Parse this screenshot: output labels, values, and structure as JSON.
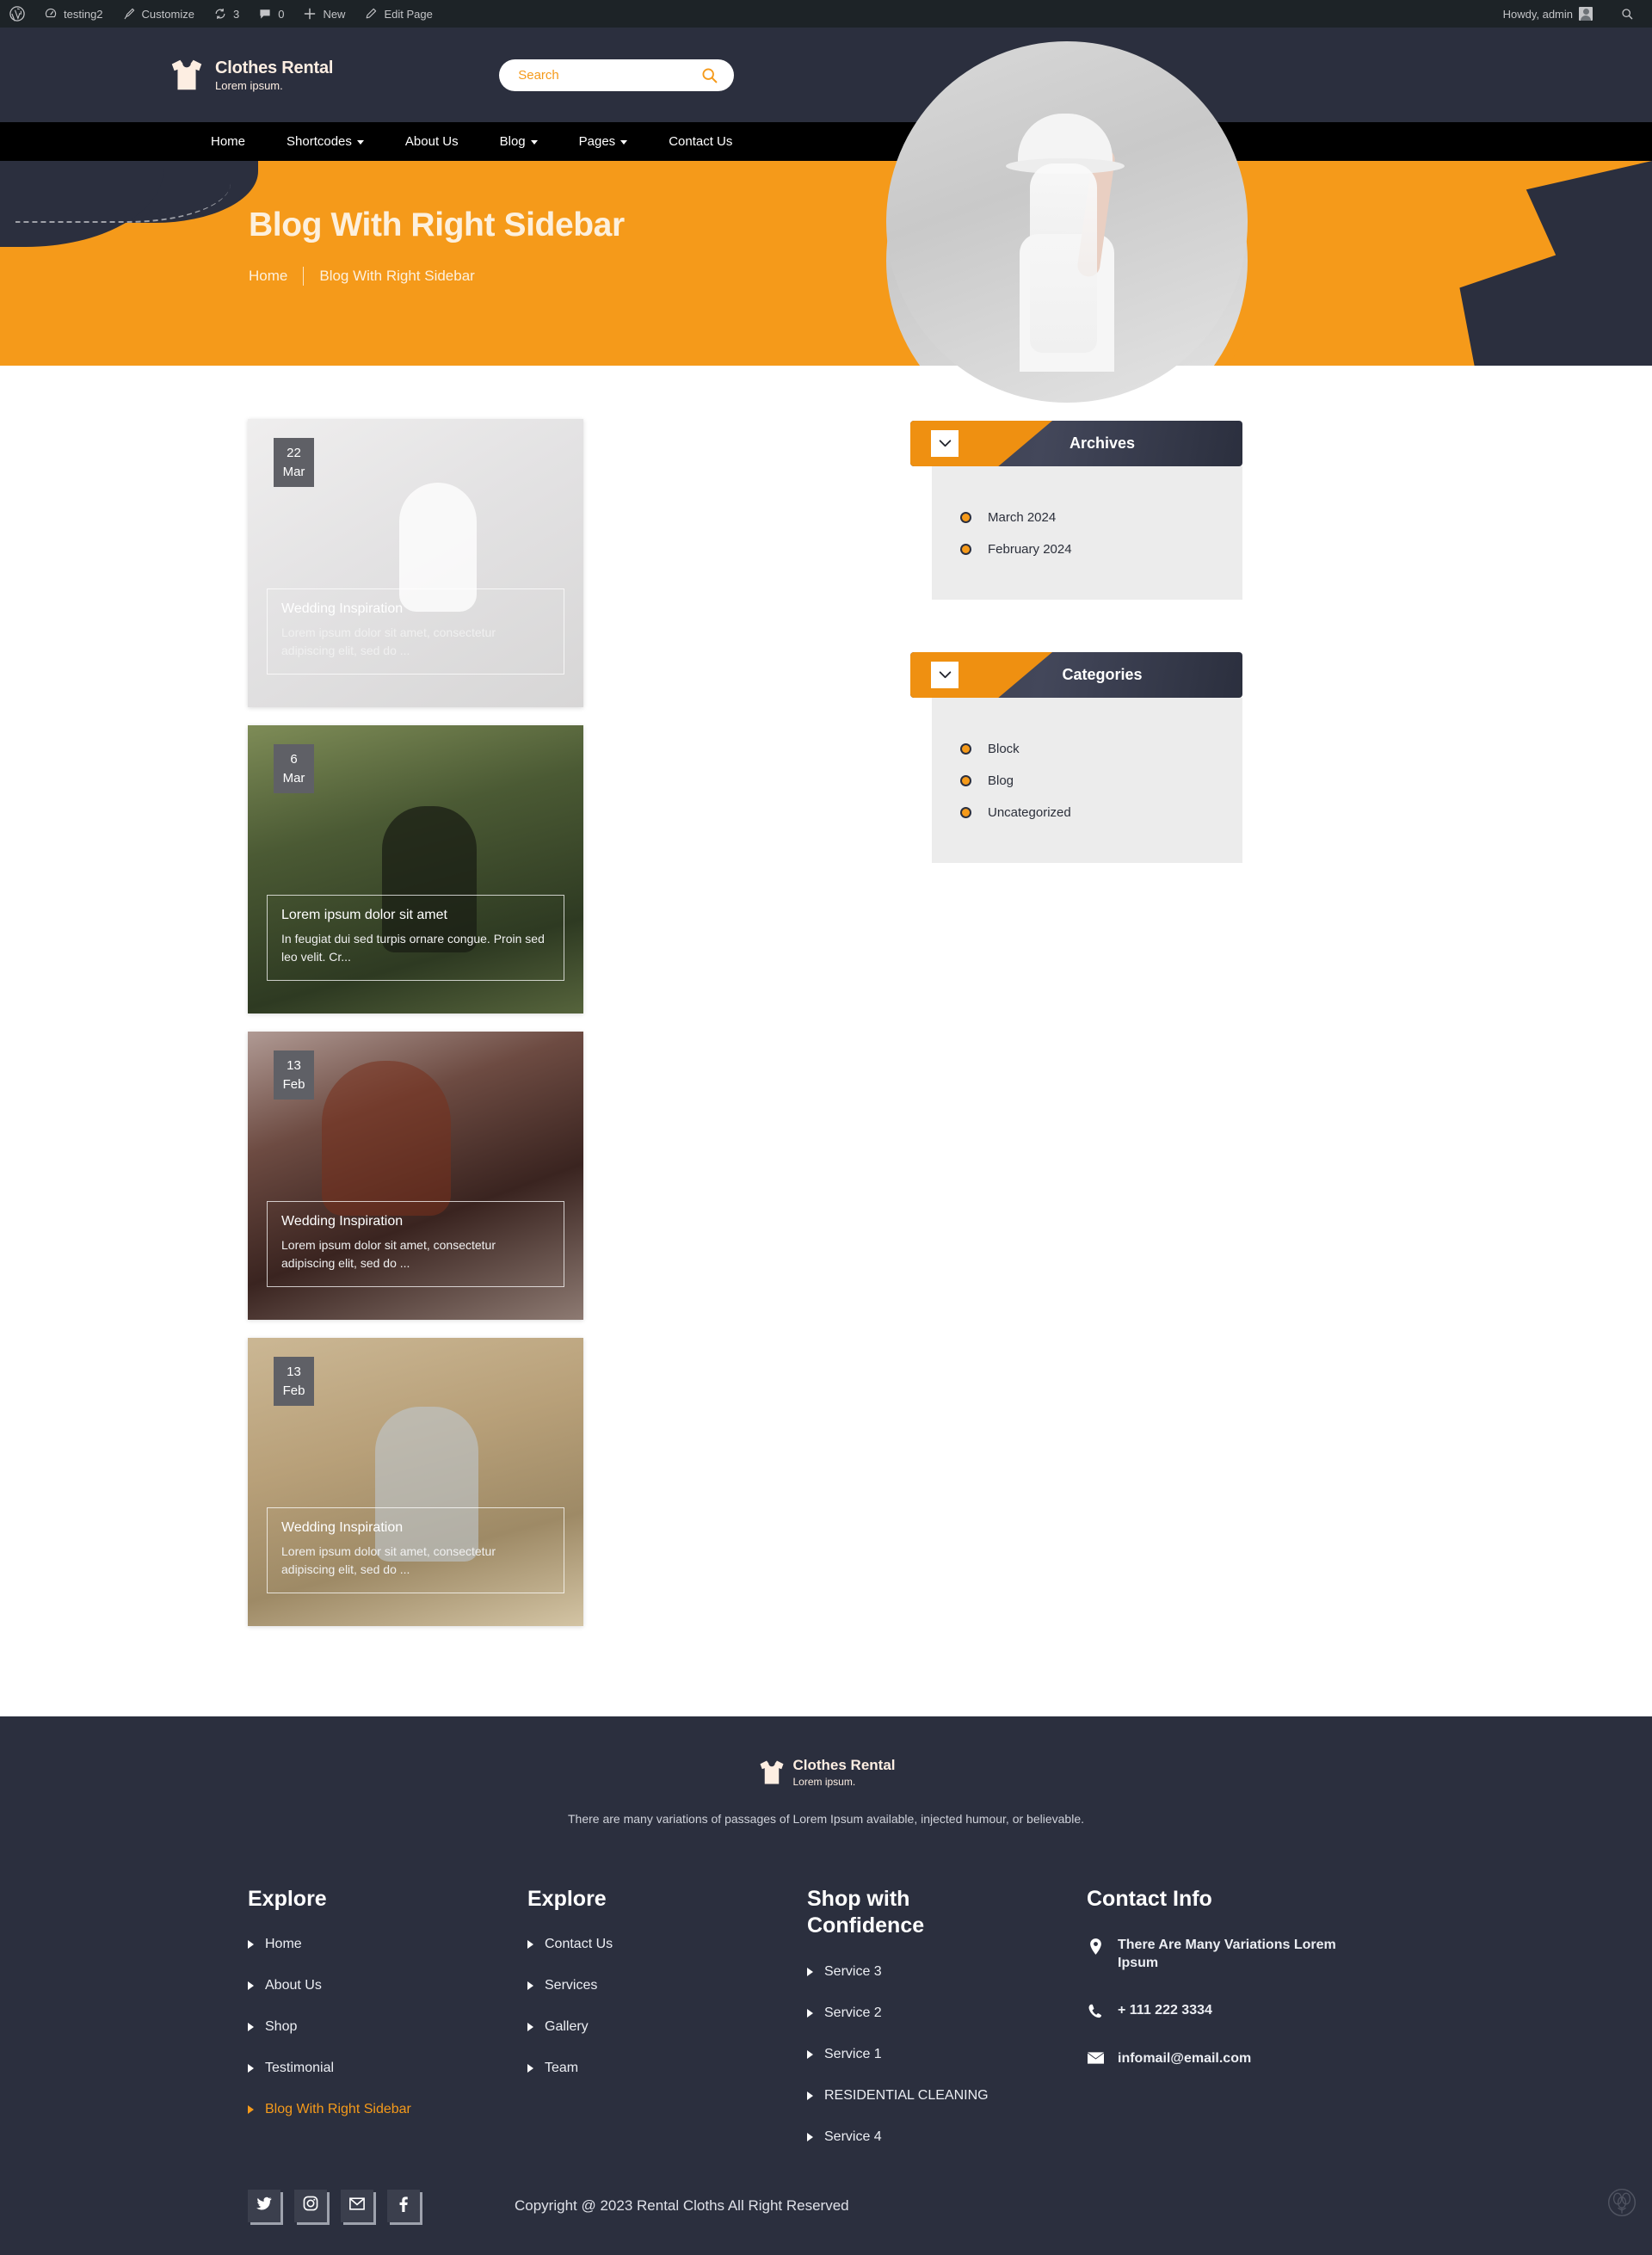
{
  "adminbar": {
    "wp_logo": "wordpress-icon",
    "site_name": "testing2",
    "customize": "Customize",
    "updates_count": "3",
    "comments_count": "0",
    "new": "New",
    "edit_page": "Edit Page",
    "howdy": "Howdy, admin",
    "search_icon": "search-icon"
  },
  "header": {
    "brand_title": "Clothes Rental",
    "brand_sub": "Lorem ipsum.",
    "search_placeholder": "Search",
    "search_value": "",
    "search_icon": "search-icon"
  },
  "nav": {
    "items": [
      {
        "label": "Home",
        "has_caret": false
      },
      {
        "label": "Shortcodes",
        "has_caret": true
      },
      {
        "label": "About Us",
        "has_caret": false
      },
      {
        "label": "Blog",
        "has_caret": true
      },
      {
        "label": "Pages",
        "has_caret": true
      },
      {
        "label": "Contact Us",
        "has_caret": false
      }
    ]
  },
  "banner": {
    "title": "Blog With Right Sidebar",
    "crumb_home": "Home",
    "crumb_current": "Blog With Right Sidebar"
  },
  "posts": [
    {
      "day": "22",
      "month": "Mar",
      "title": "Wedding Inspiration",
      "excerpt": "Lorem ipsum dolor sit amet, consectetur adipiscing elit, sed do ...",
      "image": "bride-in-white-dress"
    },
    {
      "day": "6",
      "month": "Mar",
      "title": "Lorem ipsum dolor sit amet",
      "excerpt": "In feugiat dui sed turpis ornare congue. Proin sed leo velit. Cr...",
      "image": "woman-in-black-dress-outdoors"
    },
    {
      "day": "13",
      "month": "Feb",
      "title": "Wedding Inspiration",
      "excerpt": "Lorem ipsum dolor sit amet, consectetur adipiscing elit, sed do ...",
      "image": "redhead-woman-portrait"
    },
    {
      "day": "13",
      "month": "Feb",
      "title": "Wedding Inspiration",
      "excerpt": "Lorem ipsum dolor sit amet, consectetur adipiscing elit, sed do ...",
      "image": "blonde-woman-in-field"
    }
  ],
  "sidebar": {
    "widgets": [
      {
        "title": "Archives",
        "toggle_icon": "chevron-down-icon",
        "items": [
          "March 2024",
          "February 2024"
        ]
      },
      {
        "title": "Categories",
        "toggle_icon": "chevron-down-icon",
        "items": [
          "Block",
          "Blog",
          "Uncategorized"
        ]
      }
    ]
  },
  "footer": {
    "brand_title": "Clothes Rental",
    "brand_sub": "Lorem ipsum.",
    "tagline": "There are many variations of passages of Lorem Ipsum available, injected humour, or believable.",
    "columns": [
      {
        "heading": "Explore",
        "links": [
          {
            "label": "Home",
            "active": false
          },
          {
            "label": "About Us",
            "active": false
          },
          {
            "label": "Shop",
            "active": false
          },
          {
            "label": "Testimonial",
            "active": false
          },
          {
            "label": "Blog With Right Sidebar",
            "active": true
          }
        ]
      },
      {
        "heading": "Explore",
        "links": [
          {
            "label": "Contact Us",
            "active": false
          },
          {
            "label": "Services",
            "active": false
          },
          {
            "label": "Gallery",
            "active": false
          },
          {
            "label": "Team",
            "active": false
          }
        ]
      },
      {
        "heading": "Shop with Confidence",
        "links": [
          {
            "label": "Service 3",
            "active": false
          },
          {
            "label": "Service 2",
            "active": false
          },
          {
            "label": "Service 1",
            "active": false
          },
          {
            "label": "RESIDENTIAL CLEANING",
            "active": false
          },
          {
            "label": "Service 4",
            "active": false
          }
        ]
      }
    ],
    "contact": {
      "heading": "Contact Info",
      "address": "There Are Many Variations Lorem Ipsum",
      "phone": "+ 111 222 3334",
      "email": "infomail@email.com",
      "address_icon": "location-pin-icon",
      "phone_icon": "phone-icon",
      "email_icon": "envelope-icon"
    },
    "socials": [
      {
        "name": "twitter-icon"
      },
      {
        "name": "instagram-icon"
      },
      {
        "name": "mail-icon"
      },
      {
        "name": "facebook-icon"
      }
    ],
    "copyright": "Copyright @ 2023 Rental Cloths All Right Reserved",
    "corner_icon": "cotton-flower-icon"
  },
  "colors": {
    "accent": "#f59a1a",
    "dark": "#2b2f3e",
    "nav_black": "#000000",
    "widget_body": "#ececec",
    "admin_bar": "#1d2327"
  }
}
